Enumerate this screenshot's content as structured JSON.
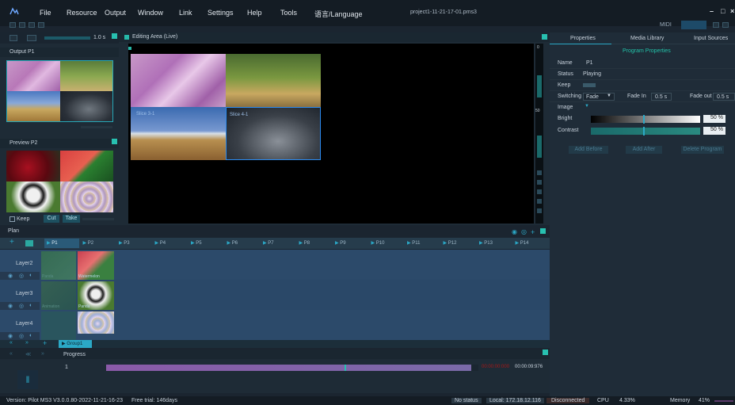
{
  "menu": {
    "items": [
      "File",
      "Resource",
      "Output",
      "Window",
      "Link",
      "Settings",
      "Help",
      "Tools",
      "语言/Language"
    ],
    "project_title": "project1-11-21-17-01.pms3",
    "midi": "MIDI"
  },
  "output": {
    "duration": "1.0 s",
    "title": "Output  P1"
  },
  "preview": {
    "title": "Preview  P2",
    "keep": "Keep",
    "cut": "Cut",
    "take": "Take"
  },
  "editor": {
    "title": "Editing Area (Live)",
    "slices": [
      "Slice 3-1",
      "Slice 4-1"
    ],
    "ruler": [
      "0",
      "50"
    ]
  },
  "right": {
    "tabs": [
      "Properties",
      "Media Library",
      "Input Sources"
    ],
    "subtitle": "Program Properties",
    "name_label": "Name",
    "name_value": "P1",
    "status_label": "Status",
    "status_value": "Playing",
    "keep_label": "Keep",
    "switching_label": "Switching",
    "switching_value": "Fade",
    "fade_in_label": "Fade In",
    "fade_in_value": "0.5  s",
    "fade_out_label": "Fade out",
    "fade_out_value": "0.5  s",
    "image_label": "Image",
    "bright_label": "Bright",
    "bright_value": "50  %",
    "contrast_label": "Contrast",
    "contrast_value": "50  %",
    "add_before": "Add Before",
    "add_after": "Add After",
    "delete_program": "Delete Program"
  },
  "plan": {
    "title": "Plan",
    "programs": [
      "P1",
      "P2",
      "P3",
      "P4",
      "P5",
      "P6",
      "P7",
      "P8",
      "P9",
      "P10",
      "P11",
      "P12",
      "P13",
      "P14"
    ],
    "layers": [
      "Layer2",
      "Layer3",
      "Layer4"
    ],
    "captions": [
      "Panda",
      "Watermelon",
      "Animation",
      "Panda"
    ],
    "group": "Group1"
  },
  "progress": {
    "title": "Progress",
    "row": "1",
    "time_red": "00:00:00:000",
    "time": "00:00:09:976",
    "fill_fraction": 0.98
  },
  "status": {
    "version": "Version: Pilot MS3 V3.0.0.80-2022-11-21-16-23",
    "trial": "Free trial: 146days",
    "nostatus": "No status",
    "local": "Local: 172.18.12.116",
    "disconnected": "Disconnected",
    "cpu_label": "CPU",
    "cpu_value": "4.33%",
    "memory_label": "Memory",
    "memory_value": "41%"
  },
  "colors": {
    "accent": "#2ba8c6",
    "teal": "#22c2c2",
    "purple": "#8a5aa8"
  }
}
